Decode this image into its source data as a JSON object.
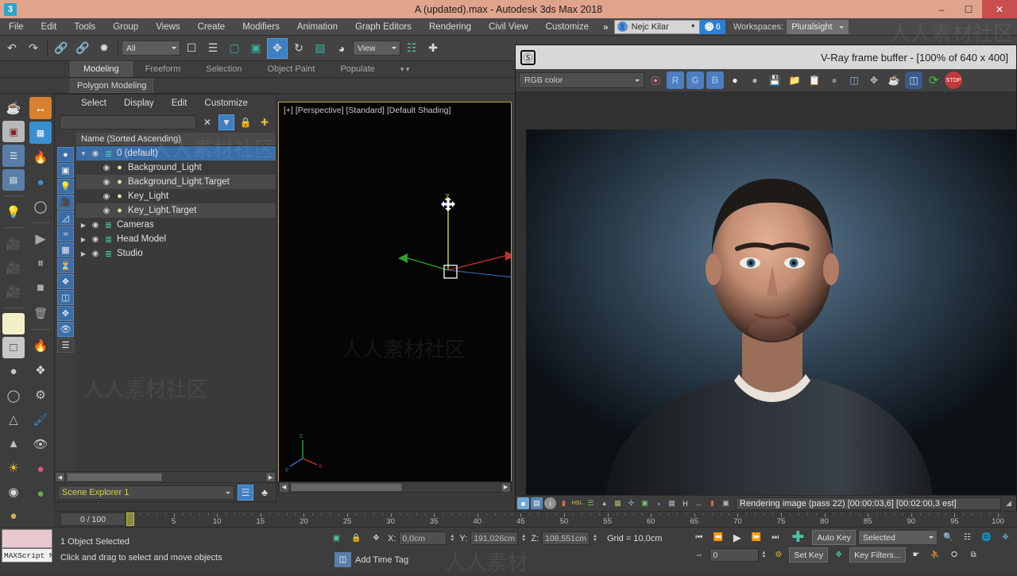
{
  "titlebar": {
    "app_icon": "3dsmax-icon",
    "title": "A (updated).max - Autodesk 3ds Max 2018",
    "minimize": "minimize-icon",
    "maximize": "maximize-icon",
    "close": "close-icon"
  },
  "menubar": {
    "items": [
      "File",
      "Edit",
      "Tools",
      "Group",
      "Views",
      "Create",
      "Modifiers",
      "Animation",
      "Graph Editors",
      "Rendering",
      "Civil View",
      "Customize"
    ],
    "overflow": "»",
    "user_name": "Nejc Kilar",
    "notification_count": "6",
    "workspaces_label": "Workspaces:",
    "workspace_value": "Pluralsight"
  },
  "main_toolbar": {
    "undo": "undo-icon",
    "redo": "redo-icon",
    "select_link": "select-and-link-icon",
    "unlink": "unlink-selection-icon",
    "bind_space_warp": "bind-to-space-warp-icon",
    "filter_value": "All",
    "select_object": "select-object-icon",
    "select_by_name": "select-by-name-icon",
    "select_region": "select-region-icon",
    "window_crossing": "window-crossing-icon",
    "select_move": "select-and-move-icon",
    "select_rotate": "select-and-rotate-icon",
    "select_scale": "select-and-scale-icon",
    "placement": "placement-tool-icon",
    "ref_coord_value": "View",
    "pivot": "use-pivot-point-center-icon",
    "snap": "snaps-toggle-icon"
  },
  "ribbon": {
    "tabs": [
      "Modeling",
      "Freeform",
      "Selection",
      "Object Paint",
      "Populate"
    ],
    "active_tab": "Modeling",
    "panel_label": "Polygon Modeling",
    "overflow": "dropdown-icon"
  },
  "left_toolbar": {
    "column_a": [
      "teapot-icon",
      "render-setup-icon",
      "command-panel-icon",
      "sliders-icon",
      "light-lister-icon",
      "camera-icon",
      "camera-dark-icon",
      "camera-red-icon",
      "sheet-icon",
      "cube-icon",
      "sphere-icon",
      "cylinder-icon",
      "trash-icon",
      "sun-icon",
      "circle-icon"
    ],
    "column_b": [
      "mirror-icon",
      "grid-water-icon",
      "fire-icon",
      "water-icon",
      "color-dots-icon",
      "play-icon",
      "pause-icon",
      "stop-icon",
      "delete-icon",
      "flame-icon",
      "spiral-icon",
      "gear-icon",
      "paint-icon",
      "eye-icon"
    ]
  },
  "scene_explorer": {
    "menu": [
      "Select",
      "Display",
      "Edit",
      "Customize"
    ],
    "search_value": "",
    "search_placeholder": "",
    "clear_icon": "clear-x-icon",
    "filter_icon": "filter-icon",
    "lock_icon": "lock-icon",
    "add_icon": "add-layer-icon",
    "column_header": "Name (Sorted Ascending)",
    "side_icons": [
      "circle-icon",
      "geometry-icon",
      "light-icon",
      "camera-icon",
      "helper-icon",
      "spacewarp-icon",
      "group-icon",
      "xref-icon",
      "bone-icon",
      "container-icon",
      "particle-icon",
      "eye-icon",
      "list-icon"
    ],
    "rows": [
      {
        "label": "0 (default)",
        "indent": 0,
        "triangle": "▼",
        "eye": "◉",
        "icon": "layer-icon",
        "selected": true,
        "alt": false
      },
      {
        "label": "Background_Light",
        "indent": 1,
        "triangle": "",
        "eye": "◉",
        "icon": "light-icon",
        "selected": false,
        "alt": false
      },
      {
        "label": "Background_Light.Target",
        "indent": 1,
        "triangle": "",
        "eye": "◉",
        "icon": "light-icon",
        "selected": false,
        "alt": true
      },
      {
        "label": "Key_Light",
        "indent": 1,
        "triangle": "",
        "eye": "◉",
        "icon": "light-icon",
        "selected": false,
        "alt": false
      },
      {
        "label": "Key_Light.Target",
        "indent": 1,
        "triangle": "",
        "eye": "◉",
        "icon": "light-icon",
        "selected": false,
        "alt": true
      },
      {
        "label": "Cameras",
        "indent": 0,
        "triangle": "▶",
        "eye": "◉",
        "icon": "layer-icon",
        "selected": false,
        "alt": false
      },
      {
        "label": "Head Model",
        "indent": 0,
        "triangle": "▶",
        "eye": "◉",
        "icon": "layer-icon",
        "selected": false,
        "alt": false
      },
      {
        "label": "Studio",
        "indent": 0,
        "triangle": "▶",
        "eye": "◉",
        "icon": "layer-icon",
        "selected": false,
        "alt": false
      }
    ],
    "footer_name": "Scene Explorer 1",
    "footer_layer_icon": "layer-view-icon",
    "footer_hier_icon": "hierarchy-view-icon"
  },
  "viewport": {
    "label": "[+] [Perspective] [Standard] [Default Shading]",
    "gizmo_axis_z": "Z",
    "move_cursor": "move-gizmo-icon",
    "axis_colors": {
      "x": "#c03030",
      "y": "#2fa02f",
      "z": "#d8d840"
    }
  },
  "vray": {
    "window_icon": "vray-logo-icon",
    "title": "V-Ray frame buffer - [100% of 640 x 400]",
    "channel_value": "RGB color",
    "buttons": [
      {
        "name": "color-channels-icon",
        "glyph": "●"
      },
      {
        "name": "red-channel-icon",
        "glyph": "R",
        "active": true
      },
      {
        "name": "green-channel-icon",
        "glyph": "G",
        "active": true
      },
      {
        "name": "blue-channel-icon",
        "glyph": "B",
        "active": true
      },
      {
        "name": "alpha-channel-icon",
        "glyph": "●"
      },
      {
        "name": "monochrome-icon",
        "glyph": "●"
      },
      {
        "name": "save-image-icon",
        "glyph": "▣"
      },
      {
        "name": "load-image-icon",
        "glyph": "▱"
      },
      {
        "name": "clipboard-icon",
        "glyph": "▤"
      },
      {
        "name": "clear-image-icon",
        "glyph": "●"
      },
      {
        "name": "duplicate-vfb-icon",
        "glyph": "◰"
      },
      {
        "name": "region-render-icon",
        "glyph": "✥"
      },
      {
        "name": "render-last-icon",
        "glyph": "◕"
      },
      {
        "name": "ab-compare-icon",
        "glyph": "◫"
      },
      {
        "name": "render-refresh-icon",
        "glyph": "⟳"
      },
      {
        "name": "stop-render-icon",
        "glyph": "●"
      }
    ],
    "status_icons": [
      "srgb-icon",
      "icc-icon",
      "info-icon",
      "color-corrections-icon",
      "hsl-icon",
      "levels-icon",
      "curve-icon",
      "lut-icon",
      "exposure-icon",
      "white-balance-icon",
      "hue-icon",
      "lut-table-icon",
      "histogram-icon",
      "horizontal-icon",
      "vertical-icon",
      "bar-icon",
      "pixel-icon"
    ],
    "status_text": "Rendering image (pass 22) [00:00:03,6] [00:02:00,3 est]"
  },
  "timeline": {
    "start": 0,
    "end": 100,
    "major_step": 5,
    "labels": [
      0,
      5,
      10,
      15,
      20,
      25,
      30,
      35,
      40,
      45,
      50,
      55,
      60,
      65,
      70,
      75,
      80,
      85,
      90,
      95,
      100
    ],
    "current_frame": 0,
    "frame_readout": "0 / 100",
    "prev_arrow": "<",
    "next_arrow": ">"
  },
  "status_bar": {
    "maxscript_label": "MAXScript Mi",
    "selection_text": "1 Object Selected",
    "prompt_text": "Click and drag to select and move objects",
    "selection_lock_icon": "selection-lock-icon",
    "lock_icon": "lock-icon",
    "absolute_mode_icon": "absolute-relative-icon",
    "x_label": "X:",
    "x_value": "0,0cm",
    "y_label": "Y:",
    "y_value": "191,026cm",
    "z_label": "Z:",
    "z_value": "108,551cm",
    "grid_text": "Grid = 10,0cm",
    "time_tag": "Add Time Tag",
    "time_tag_icon": "time-tag-icon"
  },
  "anim_controls": {
    "go_to_start": "go-to-start-icon",
    "prev_frame": "previous-frame-icon",
    "play": "play-animation-icon",
    "next_frame": "next-frame-icon",
    "go_to_end": "go-to-end-icon",
    "key_mode_icon": "key-mode-toggle-icon",
    "frame_value": "0",
    "time_config_icon": "time-configuration-icon",
    "set_key_big_icon": "set-keys-icon",
    "auto_key": "Auto Key",
    "set_key": "Set Key",
    "key_filters": "Key Filters...",
    "selected_value": "Selected",
    "key_toggle_icon": "key-toggle-icon",
    "nav": [
      {
        "name": "zoom-icon",
        "glyph": "⌕"
      },
      {
        "name": "zoom-all-icon",
        "glyph": "⬚"
      },
      {
        "name": "zoom-extents-icon",
        "glyph": "⬤"
      },
      {
        "name": "zoom-region-icon",
        "glyph": "▣"
      },
      {
        "name": "pan-icon",
        "glyph": "✋"
      },
      {
        "name": "orbit-icon",
        "glyph": "↻"
      },
      {
        "name": "field-of-view-icon",
        "glyph": "◯"
      },
      {
        "name": "maximize-viewport-icon",
        "glyph": "⤡"
      }
    ]
  },
  "watermarks": [
    "人人素材社区",
    "人人素材"
  ]
}
